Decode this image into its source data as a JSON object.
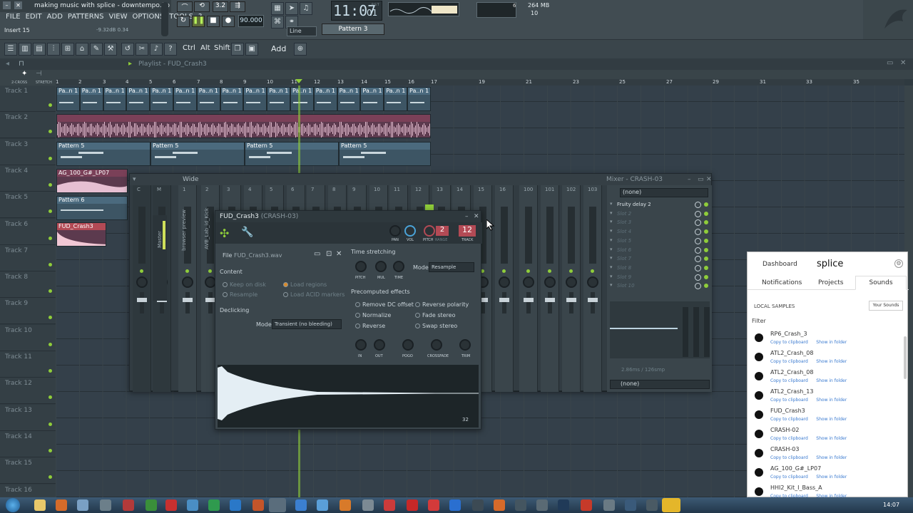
{
  "window": {
    "title": "making music with splice - downtempo.flp"
  },
  "menu": [
    "FILE",
    "EDIT",
    "ADD",
    "PATTERNS",
    "VIEW",
    "OPTIONS",
    "TOOLS",
    "?"
  ],
  "hint": {
    "label": "Insert 15",
    "value": "-9.32dB 0.34"
  },
  "transport": {
    "tempo": "90.000",
    "time": "11:07",
    "time_sub": "01",
    "time_unit": "B:S:T",
    "pattern": "Pattern 3",
    "snap": "Line",
    "memory": "264 MB",
    "cpu": "6",
    "voices": "10"
  },
  "toolbar2": [
    "Ctrl",
    "Alt",
    "Shift",
    "Add"
  ],
  "playlist": {
    "title": "Playlist - FUD_Crash3",
    "ruler": [
      "1",
      "2",
      "3",
      "4",
      "5",
      "6",
      "7",
      "8",
      "9",
      "10",
      "11",
      "12",
      "13",
      "14",
      "15",
      "16",
      "17",
      "19",
      "21",
      "23",
      "25",
      "27",
      "29",
      "31",
      "33",
      "35"
    ],
    "corner": "2-CROSS",
    "stretch": "STRETCH"
  },
  "tracks": [
    "Track 1",
    "Track 2",
    "Track 3",
    "Track 4",
    "Track 5",
    "Track 6",
    "Track 7",
    "Track 8",
    "Track 9",
    "Track 10",
    "Track 11",
    "Track 12",
    "Track 13",
    "Track 14",
    "Track 15",
    "Track 16"
  ],
  "clips": {
    "pa": "Pa..n 1",
    "pattern5": "Pattern 5",
    "pattern6": "Pattern 6",
    "ag": "AG_100_G#_LP07",
    "fud": "FUD_Crash3"
  },
  "mixer": {
    "title": "Mixer - CRASH-03",
    "view": "Wide",
    "channels": [
      "C",
      "M",
      "1",
      "2",
      "3",
      "4",
      "5",
      "6",
      "7",
      "8",
      "9",
      "10",
      "11",
      "12",
      "13",
      "14",
      "15",
      "16",
      "100",
      "101",
      "102",
      "103"
    ],
    "strip_names": [
      "Master",
      "browser preview",
      "AVB_Lab_id_Kick"
    ],
    "slot_none": "(none)",
    "slots": [
      "Fruity delay 2",
      "Slot 2",
      "Slot 3",
      "Slot 4",
      "Slot 5",
      "Slot 6",
      "Slot 7",
      "Slot 8",
      "Slot 9",
      "Slot 10"
    ],
    "latency": "2.86ms / 126smp",
    "bottom_none": "(none)"
  },
  "sampler": {
    "title": "FUD_Crash3",
    "subtitle": "(CRASH-03)",
    "file_label": "File",
    "file": "FUD_Crash3.wav",
    "content": "Content",
    "content_opts": [
      "Keep on disk",
      "Resample",
      "Load regions",
      "Load ACID markers"
    ],
    "declicking": "Declicking",
    "mode_label": "Mode",
    "declick_mode": "Transient (no bleeding)",
    "knobs_top": [
      "PAN",
      "VOL",
      "PITCH",
      "RANGE",
      "TRACK"
    ],
    "range_val": "2",
    "track_val": "12",
    "time_stretching": "Time stretching",
    "ts_knobs": [
      "PITCH",
      "MUL",
      "TIME"
    ],
    "ts_mode": "Resample",
    "precomp": "Precomputed effects",
    "effects": [
      "Remove DC offset",
      "Normalize",
      "Reverse",
      "Reverse polarity",
      "Fade stereo",
      "Swap stereo"
    ],
    "fx_knobs": [
      "IN",
      "OUT",
      "POGO",
      "CROSSFADE",
      "TRIM"
    ],
    "zoom": "32"
  },
  "splice": {
    "dashboard": "Dashboard",
    "logo": "splice",
    "tabs": [
      "Notifications",
      "Projects",
      "Sounds"
    ],
    "local": "LOCAL SAMPLES",
    "your_sounds": "Your Sounds",
    "filter": "Filter",
    "copy": "Copy to clipboard",
    "show": "Show in folder",
    "samples": [
      "RP6_Crash_3",
      "ATL2_Crash_08",
      "ATL2_Crash_08",
      "ATL2_Crash_13",
      "FUD_Crash3",
      "CRASH-02",
      "CRASH-03",
      "AG_100_G#_LP07",
      "HHI2_Kit_I_Bass_A"
    ]
  },
  "taskbar": {
    "time": "14:07"
  },
  "colors": {
    "accent_green": "#8fcd3a",
    "clip_blue": "#4b6a7e",
    "clip_pink": "#7a4058",
    "clip_red": "#b34a55"
  }
}
